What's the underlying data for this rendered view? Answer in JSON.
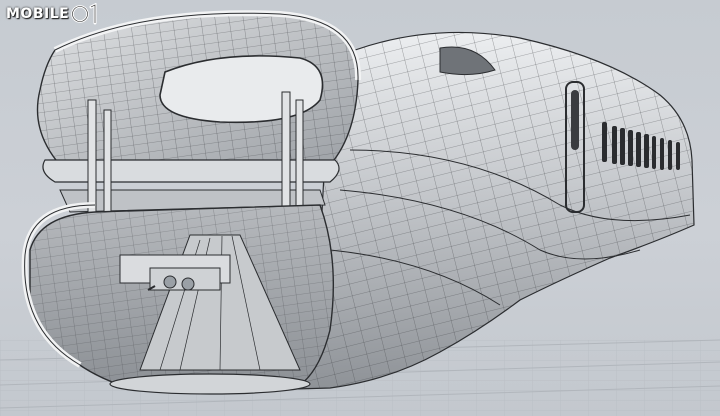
{
  "watermark": {
    "text": "MOBILE01",
    "word": "MOBILE",
    "icon": "mobile01-logo-icon"
  },
  "scene": {
    "subject": "wireframe-train-nose-cutaway",
    "colors": {
      "background": "#c9ced4",
      "shell_light": "#e4e6e8",
      "shell_mid": "#b9bcc0",
      "shell_dark": "#8f9398",
      "interior": "#a7abb0",
      "wire": "#2b2d30"
    }
  }
}
